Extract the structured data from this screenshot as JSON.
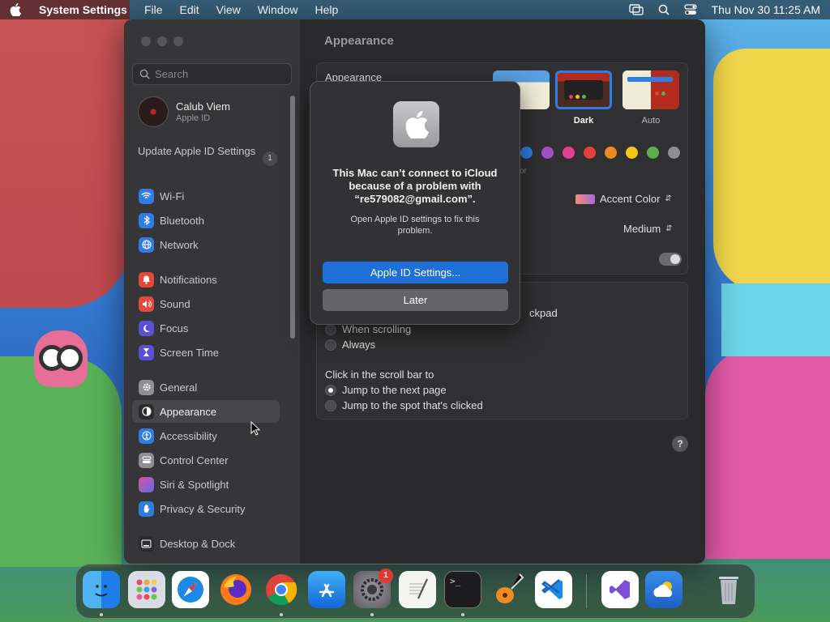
{
  "menubar": {
    "app_name": "System Settings",
    "items": [
      "File",
      "Edit",
      "View",
      "Window",
      "Help"
    ],
    "clock": "Thu Nov 30  11:25 AM"
  },
  "sidebar": {
    "search_placeholder": "Search",
    "profile": {
      "name": "Calub Viem",
      "subtitle": "Apple ID"
    },
    "update": {
      "label": "Update Apple ID Settings",
      "badge": "1"
    },
    "items": [
      {
        "label": "Wi-Fi",
        "icon": "wifi-icon",
        "color": "#2f7de1"
      },
      {
        "label": "Bluetooth",
        "icon": "bluetooth-icon",
        "color": "#2f7de1"
      },
      {
        "label": "Network",
        "icon": "globe-icon",
        "color": "#2f7de1"
      },
      {
        "label": "Notifications",
        "icon": "bell-icon",
        "color": "#e4473c"
      },
      {
        "label": "Sound",
        "icon": "speaker-icon",
        "color": "#e4473c"
      },
      {
        "label": "Focus",
        "icon": "moon-icon",
        "color": "#5a4fd6"
      },
      {
        "label": "Screen Time",
        "icon": "hourglass-icon",
        "color": "#5a4fd6"
      },
      {
        "label": "General",
        "icon": "gear-icon",
        "color": "#8e8e93"
      },
      {
        "label": "Appearance",
        "icon": "appearance-icon",
        "color": "#2c2c2e"
      },
      {
        "label": "Accessibility",
        "icon": "accessibility-icon",
        "color": "#2f7de1"
      },
      {
        "label": "Control Center",
        "icon": "control-center-icon",
        "color": "#8e8e93"
      },
      {
        "label": "Siri & Spotlight",
        "icon": "siri-icon",
        "color": "#b455d8"
      },
      {
        "label": "Privacy & Security",
        "icon": "hand-icon",
        "color": "#2f7de1"
      },
      {
        "label": "Desktop & Dock",
        "icon": "dock-icon",
        "color": "#2c2c2e"
      }
    ]
  },
  "main": {
    "title": "Appearance",
    "appearance_label": "Appearance",
    "themes": [
      {
        "label": "nt"
      },
      {
        "label": "Dark"
      },
      {
        "label": "Auto"
      }
    ],
    "accent_colors": [
      "#2f7de1",
      "#a24fc4",
      "#e3418f",
      "#e8413d",
      "#ee8a1f",
      "#f5c518",
      "#5ab04c",
      "#8e8e93"
    ],
    "accent_sublabel": "or",
    "highlight_value": "Accent Color",
    "sidebar_icon_size": "Medium",
    "scroll_partial": "ckpad",
    "show_scroll_options": [
      "When scrolling",
      "Always"
    ],
    "click_scroll_label": "Click in the scroll bar to",
    "click_scroll_options": [
      "Jump to the next page",
      "Jump to the spot that's clicked"
    ],
    "help": "?"
  },
  "alert": {
    "title": "This Mac can’t connect to iCloud because of a problem with “re579082@gmail.com”.",
    "body": "Open Apple ID settings to fix this problem.",
    "primary_button": "Apple ID Settings...",
    "secondary_button": "Later"
  },
  "dock": {
    "settings_badge": "1"
  }
}
